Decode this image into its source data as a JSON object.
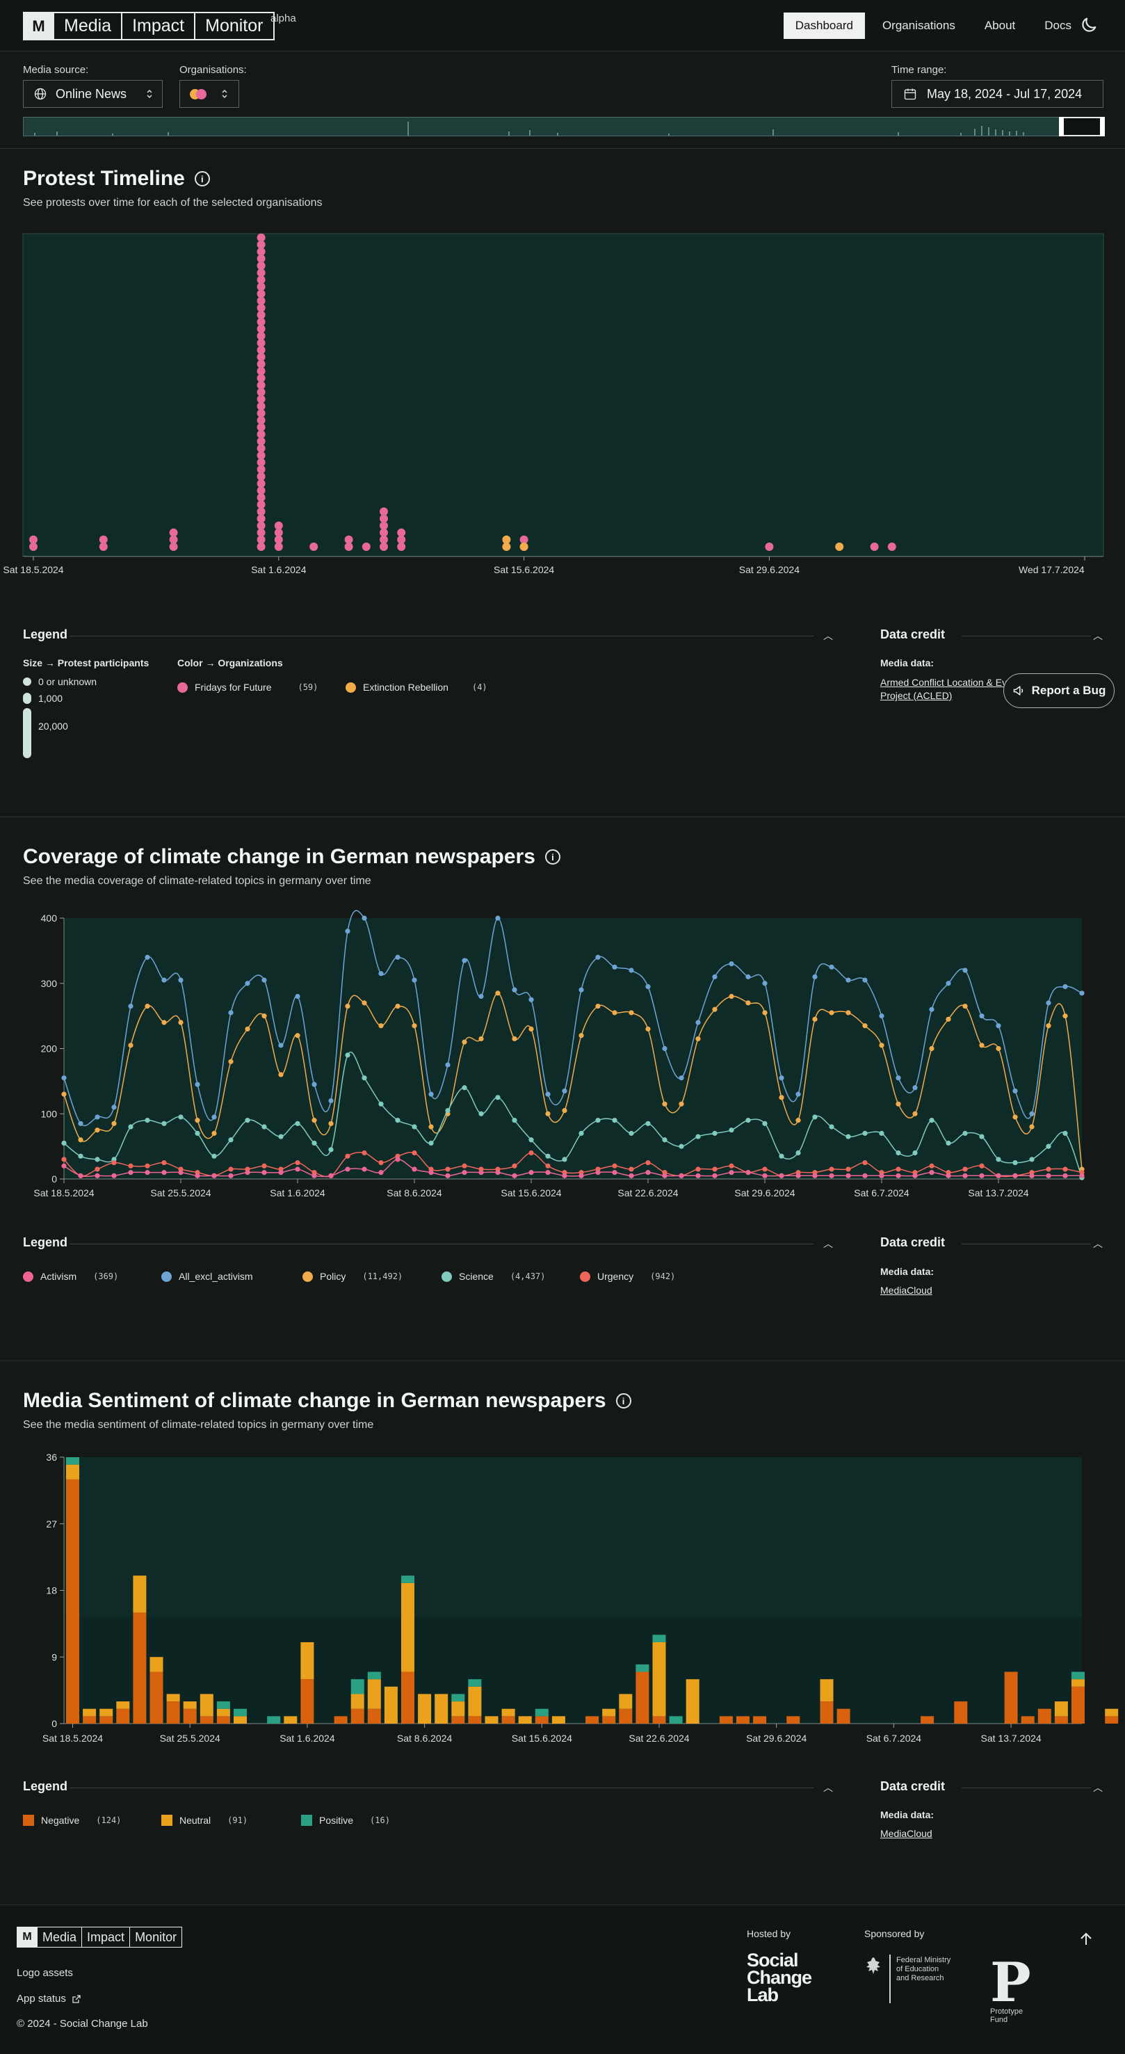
{
  "header": {
    "logo": {
      "mark": "M",
      "words": [
        "Media",
        "Impact",
        "Monitor"
      ]
    },
    "badge": "alpha",
    "nav": [
      {
        "label": "Dashboard",
        "active": true
      },
      {
        "label": "Organisations",
        "active": false
      },
      {
        "label": "About",
        "active": false
      },
      {
        "label": "Docs",
        "active": false
      }
    ],
    "theme_icon": "moon-icon"
  },
  "filters": {
    "media_source": {
      "label": "Media source:",
      "value": "Online News",
      "icon": "globe-icon"
    },
    "organisations": {
      "label": "Organisations:"
    },
    "time_range": {
      "label": "Time range:",
      "value": "May 18, 2024 - Jul 17, 2024",
      "icon": "calendar-icon"
    }
  },
  "protest": {
    "title": "Protest Timeline",
    "subtitle": "See protests over time for each of the selected organisations",
    "legend": {
      "title": "Legend",
      "size_label": "Size",
      "size_target": "Protest participants",
      "color_label": "Color",
      "color_target": "Organizations",
      "sizes": [
        "0 or unknown",
        "1,000",
        "20,000"
      ],
      "orgs": [
        {
          "name": "Fridays for Future",
          "count": "(59)",
          "color": "#e8689a"
        },
        {
          "name": "Extinction Rebellion",
          "count": "(4)",
          "color": "#f2ab4a"
        }
      ]
    },
    "credit": {
      "title": "Data credit",
      "label": "Media data:",
      "link": "Armed Conflict Location & Event Data Project (ACLED)"
    }
  },
  "report_bug": "Report a Bug",
  "coverage": {
    "title": "Coverage of climate change in German newspapers",
    "subtitle": "See the media coverage of climate-related topics in germany over time",
    "legend": {
      "title": "Legend",
      "items": [
        {
          "name": "Activism",
          "count": "(369)",
          "color": "#ee6593"
        },
        {
          "name": "All_excl_activism",
          "count": "(?)",
          "color": "#6ea4d4"
        },
        {
          "name": "Policy",
          "count": "(11,492)",
          "color": "#f2ab4a"
        },
        {
          "name": "Science",
          "count": "(4,437)",
          "color": "#7fcbbd"
        },
        {
          "name": "Urgency",
          "count": "(942)",
          "color": "#f0665a"
        }
      ]
    },
    "credit": {
      "title": "Data credit",
      "label": "Media data:",
      "link": "MediaCloud"
    }
  },
  "sentiment": {
    "title": "Media Sentiment of climate change in German newspapers",
    "subtitle": "See the media sentiment of climate-related topics in germany over time",
    "legend": {
      "title": "Legend",
      "items": [
        {
          "name": "Negative",
          "count": "(124)",
          "color": "#d9620f"
        },
        {
          "name": "Neutral",
          "count": "(91)",
          "color": "#eaa21d"
        },
        {
          "name": "Positive",
          "count": "(16)",
          "color": "#2ba183"
        }
      ]
    },
    "credit": {
      "title": "Data credit",
      "label": "Media data:",
      "link": "MediaCloud"
    }
  },
  "chart_data": [
    {
      "type": "scatter",
      "name": "protest-timeline",
      "x_ticks": [
        "Sat 18.5.2024",
        "Sat 1.6.2024",
        "Sat 15.6.2024",
        "Sat 29.6.2024",
        "Wed 17.7.2024"
      ],
      "series": [
        {
          "name": "Fridays for Future",
          "color": "#e8689a",
          "points": [
            {
              "day": 0,
              "n": 2
            },
            {
              "day": 4,
              "n": 2
            },
            {
              "day": 8,
              "n": 2
            },
            {
              "day": 8,
              "n": 1
            },
            {
              "day": 13,
              "n": 45
            },
            {
              "day": 14,
              "n": 4
            },
            {
              "day": 16,
              "n": 1
            },
            {
              "day": 18,
              "n": 2
            },
            {
              "day": 19,
              "n": 1
            },
            {
              "day": 20,
              "n": 6
            },
            {
              "day": 21,
              "n": 3
            },
            {
              "day": 28,
              "n": 2
            },
            {
              "day": 42,
              "n": 1
            },
            {
              "day": 48,
              "n": 1
            },
            {
              "day": 49,
              "n": 1
            }
          ]
        },
        {
          "name": "Extinction Rebellion",
          "color": "#f2ab4a",
          "points": [
            {
              "day": 27,
              "n": 2
            },
            {
              "day": 28,
              "n": 1
            },
            {
              "day": 46,
              "n": 1
            }
          ]
        }
      ]
    },
    {
      "type": "line",
      "name": "coverage",
      "ylim": [
        0,
        400
      ],
      "y_ticks": [
        0,
        100,
        200,
        300,
        400
      ],
      "x_ticks": [
        "Sat 18.5.2024",
        "Sat 25.5.2024",
        "Sat 1.6.2024",
        "Sat 8.6.2024",
        "Sat 15.6.2024",
        "Sat 22.6.2024",
        "Sat 29.6.2024",
        "Sat 6.7.2024",
        "Sat 13.7.2024"
      ],
      "series": [
        {
          "name": "All_excl_activism",
          "color": "#6ea4d4",
          "values": [
            155,
            85,
            95,
            110,
            265,
            340,
            305,
            305,
            145,
            95,
            255,
            300,
            305,
            205,
            280,
            145,
            120,
            380,
            400,
            315,
            340,
            305,
            130,
            175,
            335,
            280,
            400,
            290,
            275,
            130,
            135,
            290,
            340,
            325,
            320,
            295,
            200,
            155,
            240,
            310,
            330,
            310,
            300,
            155,
            130,
            310,
            325,
            305,
            305,
            250,
            155,
            140,
            260,
            300,
            320,
            250,
            235,
            135,
            100,
            270,
            295,
            285
          ]
        },
        {
          "name": "Policy",
          "color": "#f2ab4a",
          "values": [
            130,
            60,
            75,
            85,
            205,
            265,
            240,
            240,
            90,
            70,
            180,
            230,
            250,
            160,
            220,
            90,
            85,
            265,
            270,
            235,
            265,
            235,
            80,
            100,
            210,
            215,
            285,
            215,
            230,
            100,
            105,
            220,
            265,
            255,
            255,
            230,
            115,
            115,
            215,
            260,
            280,
            270,
            255,
            125,
            90,
            245,
            255,
            255,
            235,
            205,
            115,
            100,
            200,
            245,
            265,
            205,
            200,
            95,
            80,
            235,
            250,
            15
          ]
        },
        {
          "name": "Science",
          "color": "#7fcbbd",
          "values": [
            55,
            35,
            30,
            30,
            80,
            90,
            85,
            95,
            70,
            35,
            60,
            90,
            80,
            65,
            85,
            55,
            45,
            190,
            155,
            115,
            90,
            80,
            55,
            105,
            140,
            100,
            125,
            90,
            60,
            35,
            30,
            70,
            90,
            90,
            70,
            85,
            60,
            50,
            65,
            70,
            75,
            90,
            85,
            35,
            40,
            95,
            80,
            65,
            70,
            70,
            40,
            40,
            90,
            55,
            70,
            65,
            30,
            25,
            30,
            50,
            70,
            2
          ]
        },
        {
          "name": "Urgency",
          "color": "#f0665a",
          "values": [
            30,
            5,
            15,
            25,
            20,
            20,
            25,
            15,
            10,
            5,
            15,
            15,
            20,
            15,
            25,
            10,
            5,
            35,
            40,
            25,
            35,
            40,
            15,
            15,
            20,
            15,
            15,
            20,
            40,
            20,
            10,
            10,
            15,
            20,
            15,
            25,
            10,
            5,
            15,
            15,
            20,
            10,
            15,
            5,
            10,
            10,
            15,
            15,
            25,
            10,
            15,
            10,
            20,
            10,
            15,
            20,
            5,
            5,
            10,
            15,
            15,
            10
          ]
        },
        {
          "name": "Activism",
          "color": "#ee6593",
          "values": [
            20,
            5,
            5,
            5,
            10,
            10,
            10,
            10,
            5,
            5,
            5,
            10,
            10,
            10,
            15,
            5,
            5,
            15,
            15,
            10,
            30,
            15,
            10,
            5,
            10,
            10,
            10,
            5,
            10,
            10,
            5,
            5,
            10,
            10,
            5,
            10,
            5,
            5,
            5,
            5,
            10,
            10,
            5,
            5,
            5,
            5,
            5,
            5,
            5,
            5,
            5,
            5,
            10,
            5,
            5,
            5,
            5,
            5,
            5,
            5,
            5,
            5
          ]
        }
      ]
    },
    {
      "type": "bar",
      "name": "sentiment",
      "stacked": true,
      "ylim": [
        0,
        36
      ],
      "y_ticks": [
        0,
        9,
        18,
        27,
        36
      ],
      "x_ticks": [
        "Sat 18.5.2024",
        "Sat 25.5.2024",
        "Sat 1.6.2024",
        "Sat 8.6.2024",
        "Sat 15.6.2024",
        "Sat 22.6.2024",
        "Sat 29.6.2024",
        "Sat 6.7.2024",
        "Sat 13.7.2024"
      ],
      "series": [
        {
          "name": "Negative",
          "color": "#d9620f",
          "values": [
            33,
            1,
            1,
            2,
            15,
            7,
            3,
            2,
            1,
            1,
            0,
            0,
            0,
            0,
            6,
            0,
            1,
            2,
            2,
            0,
            7,
            0,
            0,
            1,
            1,
            0,
            1,
            0,
            1,
            0,
            0,
            1,
            1,
            2,
            7,
            1,
            0,
            0,
            0,
            1,
            1,
            1,
            0,
            1,
            0,
            3,
            2,
            0,
            0,
            0,
            0,
            1,
            0,
            3,
            0,
            0,
            7,
            1,
            2,
            1,
            5,
            0,
            1
          ]
        },
        {
          "name": "Neutral",
          "color": "#eaa21d",
          "values": [
            2,
            1,
            1,
            1,
            5,
            2,
            1,
            1,
            3,
            1,
            1,
            0,
            0,
            1,
            5,
            0,
            0,
            2,
            4,
            5,
            12,
            4,
            4,
            2,
            4,
            1,
            1,
            1,
            0,
            1,
            0,
            0,
            1,
            2,
            0,
            10,
            0,
            6,
            0,
            0,
            0,
            0,
            0,
            0,
            0,
            3,
            0,
            0,
            0,
            0,
            0,
            0,
            0,
            0,
            0,
            0,
            0,
            0,
            0,
            2,
            1,
            0,
            1
          ]
        },
        {
          "name": "Positive",
          "color": "#2ba183",
          "values": [
            1,
            0,
            0,
            0,
            0,
            0,
            0,
            0,
            0,
            1,
            1,
            0,
            1,
            0,
            0,
            0,
            0,
            2,
            1,
            0,
            1,
            0,
            0,
            1,
            1,
            0,
            0,
            0,
            1,
            0,
            0,
            0,
            0,
            0,
            1,
            1,
            1,
            0,
            0,
            0,
            0,
            0,
            0,
            0,
            0,
            0,
            0,
            0,
            0,
            0,
            0,
            0,
            0,
            0,
            0,
            0,
            0,
            0,
            0,
            0,
            1,
            0,
            0
          ]
        }
      ]
    }
  ],
  "footer": {
    "logo": {
      "mark": "M",
      "words": [
        "Media",
        "Impact",
        "Monitor"
      ]
    },
    "links": [
      "Logo assets",
      "App status"
    ],
    "copyright": "© 2024 - Social Change Lab",
    "hosted_by": "Hosted by",
    "sponsored_by": "Sponsored by",
    "host_name": [
      "Social",
      "Change",
      "Lab"
    ],
    "sponsor_name": [
      "Federal Ministry",
      "of Education",
      "and Research"
    ],
    "sponsor2": {
      "mark": "P",
      "name": [
        "Prototype",
        "Fund"
      ]
    }
  }
}
